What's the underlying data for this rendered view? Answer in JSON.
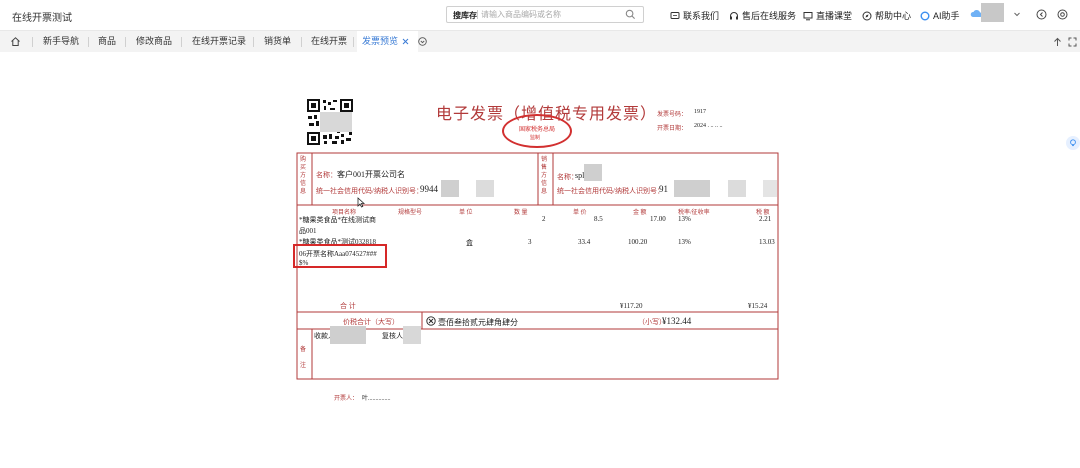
{
  "app": {
    "title": "在线开票测试"
  },
  "search": {
    "scope": "搜库存",
    "placeholder": "请输入商品编码或名称"
  },
  "topnav": {
    "contact": "联系我们",
    "after_sales": "售后在线服务",
    "live": "直播课堂",
    "help": "帮助中心",
    "ai": "AI助手"
  },
  "tabs": [
    "新手导航",
    "商品",
    "修改商品",
    "在线开票记录",
    "销货单",
    "在线开票",
    "发票预览"
  ],
  "invoice": {
    "title": "电子发票（增值税专用发票）",
    "seal_text": "国家税务总局",
    "seal_sub": "监制",
    "number_label": "发票号码：",
    "number_value": "1917",
    "date_label": "开票日期：",
    "date_value": "2024 . .. .. ..",
    "buyer_side": "购买方信息",
    "seller_side": "销售方信息",
    "buyer_name_label": "名称：",
    "buyer_name": "客户001开票公司名",
    "buyer_tax_label": "统一社会信用代码/纳税人识别号：",
    "buyer_tax": "9944",
    "seller_name_label": "名称：",
    "seller_name": "spl",
    "seller_tax_label": "统一社会信用代码/纳税人识别号：",
    "seller_tax": "91",
    "headers": [
      "项目名称",
      "规格型号",
      "单 位",
      "数 量",
      "单 价",
      "金 额",
      "税率/征收率",
      "税 额"
    ],
    "rows": [
      {
        "name1": "*糖果类食品*在线测试商",
        "name2": "品001",
        "unit": "",
        "qty": "2",
        "price": "8.5",
        "amount": "17.00",
        "rate": "13%",
        "tax": "2.21"
      },
      {
        "name1": "*糖果类食品*测试032818",
        "name2": "06开票名称Aaa074527###",
        "name3": "$%",
        "unit": "盒",
        "qty": "3",
        "price": "33.4",
        "amount": "100.20",
        "rate": "13%",
        "tax": "13.03"
      }
    ],
    "total_label": "合    计",
    "total_amount": "¥117.20",
    "total_tax": "¥15.24",
    "grand_label": "价税合计（大写）",
    "grand_upper": "壹佰叁拾贰元肆角肆分",
    "grand_small_label": "（小写）",
    "grand_small": "¥132.44",
    "notes_side": "备注",
    "payee_label": "收款人",
    "reviewer_label": "复核人",
    "issuer_label": "开票人：",
    "issuer_value": "叶..............."
  }
}
